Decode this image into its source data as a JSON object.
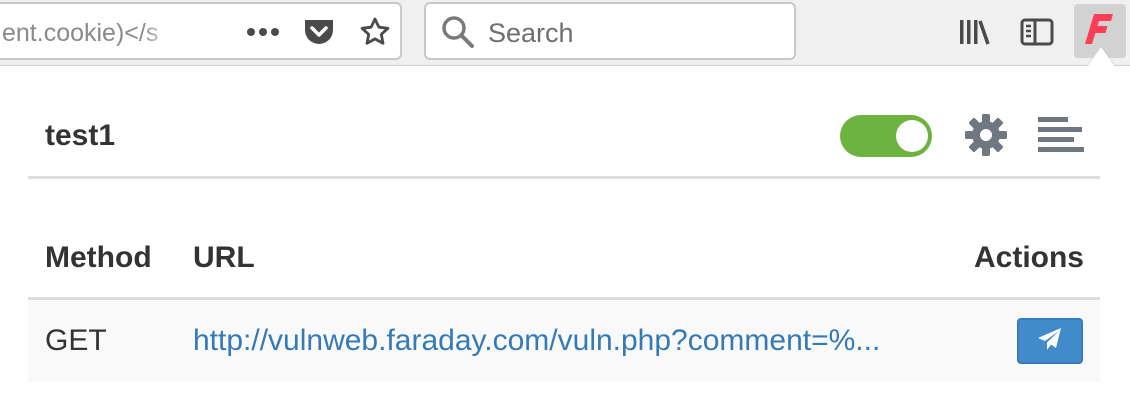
{
  "browser": {
    "url_text": "ent.cookie)</s",
    "search_placeholder": "Search",
    "icons": {
      "page_actions": "more-horizontal-icon",
      "pocket": "pocket-icon",
      "bookmark": "star-icon",
      "search": "search-icon",
      "library": "library-icon",
      "sidebar": "sidebar-icon",
      "extension": "faraday-logo-icon"
    }
  },
  "panel": {
    "project_name": "test1",
    "toggle_on": true,
    "columns": {
      "method": "Method",
      "url": "URL",
      "actions": "Actions"
    },
    "rows": [
      {
        "method": "GET",
        "url": "http://vulnweb.faraday.com/vuln.php?comment=%...",
        "action_icon": "send-icon"
      }
    ]
  },
  "colors": {
    "toggle": "#6db33f",
    "link": "#337ab7",
    "action_button": "#428bca",
    "faraday_logo": "#ff3d57"
  }
}
